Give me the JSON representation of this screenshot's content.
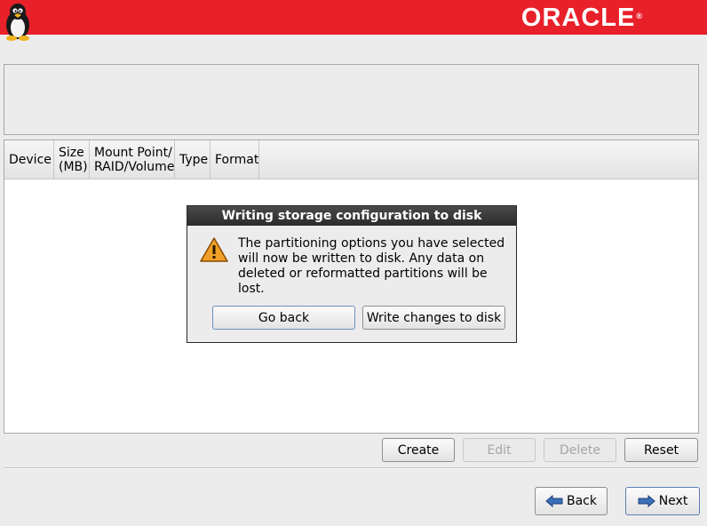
{
  "header": {
    "brand": "ORACLE",
    "brand_mark": "®"
  },
  "table": {
    "columns": [
      {
        "label": "Device",
        "width": 56
      },
      {
        "label": "Size\n(MB)",
        "width": 40
      },
      {
        "label": "Mount Point/\nRAID/Volume",
        "width": 96
      },
      {
        "label": "Type",
        "width": 40
      },
      {
        "label": "Format",
        "width": 55
      }
    ]
  },
  "actions": {
    "create": "Create",
    "edit": "Edit",
    "delete": "Delete",
    "reset": "Reset"
  },
  "nav": {
    "back": "Back",
    "next": "Next"
  },
  "dialog": {
    "title": "Writing storage configuration to disk",
    "message": "The partitioning options you have selected\nwill now be written to disk.  Any data on\ndeleted or reformatted partitions will be lost.",
    "go_back": "Go back",
    "write": "Write changes to disk"
  }
}
